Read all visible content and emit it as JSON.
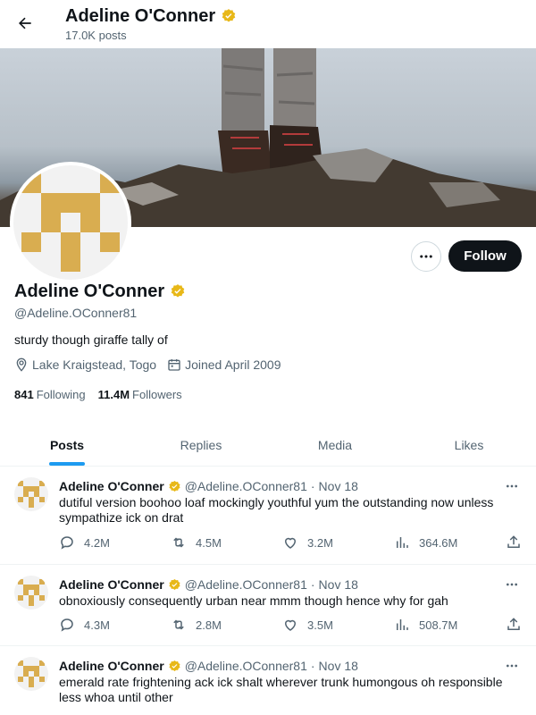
{
  "header": {
    "title": "Adeline O'Conner",
    "posts_count": "17.0K posts"
  },
  "profile": {
    "name": "Adeline O'Conner",
    "handle": "@Adeline.OConner81",
    "bio": "sturdy though giraffe tally of",
    "location": "Lake Kraigstead, Togo",
    "joined": "Joined April 2009",
    "following_count": "841",
    "following_label": "Following",
    "followers_count": "11.4M",
    "followers_label": "Followers",
    "follow_label": "Follow"
  },
  "tabs": [
    {
      "label": "Posts",
      "active": true
    },
    {
      "label": "Replies",
      "active": false
    },
    {
      "label": "Media",
      "active": false
    },
    {
      "label": "Likes",
      "active": false
    }
  ],
  "tweets": [
    {
      "name": "Adeline O'Conner",
      "handle": "@Adeline.OConner81",
      "dot": "·",
      "date": "Nov 18",
      "text": "dutiful version boohoo loaf mockingly youthful yum the outstanding now unless sympathize ick on drat",
      "replies": "4.2M",
      "reposts": "4.5M",
      "likes": "3.2M",
      "views": "364.6M"
    },
    {
      "name": "Adeline O'Conner",
      "handle": "@Adeline.OConner81",
      "dot": "·",
      "date": "Nov 18",
      "text": "obnoxiously consequently urban near mmm though hence why for gah",
      "replies": "4.3M",
      "reposts": "2.8M",
      "likes": "3.5M",
      "views": "508.7M"
    },
    {
      "name": "Adeline O'Conner",
      "handle": "@Adeline.OConner81",
      "dot": "·",
      "date": "Nov 18",
      "text": "emerald rate frightening ack ick shalt wherever trunk humongous oh responsible less whoa until other",
      "replies": "",
      "reposts": "",
      "likes": "",
      "views": ""
    }
  ],
  "colors": {
    "accent": "#1d9bf0",
    "verified": "#e8b818",
    "avatar_gold": "#d9ad50",
    "text_secondary": "#536471"
  },
  "icons": [
    "back-arrow-icon",
    "verified-badge-icon",
    "more-dots-icon",
    "location-pin-icon",
    "calendar-icon",
    "reply-icon",
    "repost-icon",
    "like-icon",
    "views-icon",
    "share-icon"
  ]
}
